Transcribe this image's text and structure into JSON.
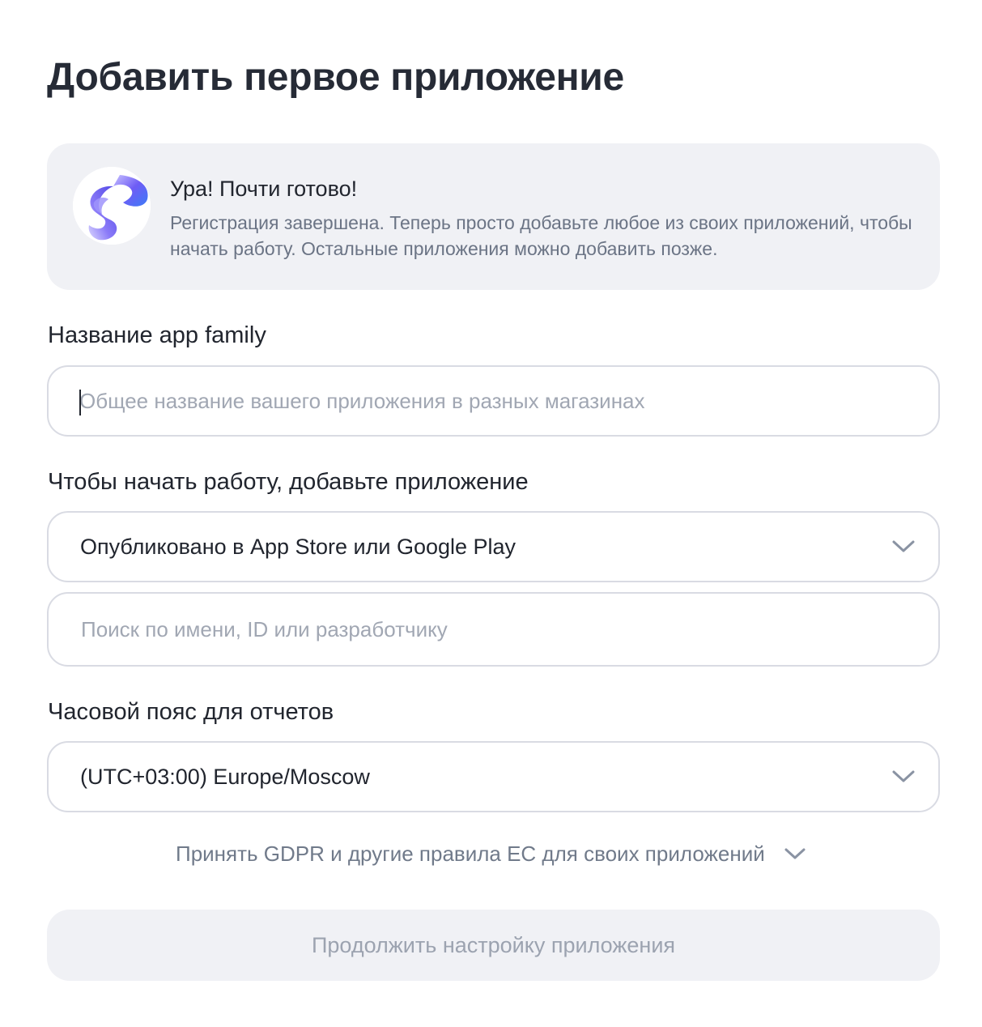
{
  "page": {
    "title": "Добавить первое приложение"
  },
  "banner": {
    "title": "Ура! Почти готово!",
    "text": "Регистрация завершена. Теперь просто добавьте любое из своих приложений, чтобы начать работу. Остальные приложения можно добавить позже."
  },
  "app_family": {
    "label": "Название app family",
    "value": "",
    "placeholder": "Общее название вашего приложения в разных магазинах"
  },
  "add_app": {
    "label": "Чтобы начать работу, добавьте приложение",
    "source_select_value": "Опубликовано в App Store или Google Play",
    "search_placeholder": "Поиск по имени, ID или разработчику"
  },
  "timezone": {
    "label": "Часовой пояс для отчетов",
    "value": "(UTC+03:00) Europe/Moscow"
  },
  "gdpr": {
    "label": "Принять GDPR и другие правила ЕС для своих приложений"
  },
  "submit": {
    "label": "Продолжить настройку приложения",
    "disabled": true
  },
  "colors": {
    "banner_bg": "#f0f1f5",
    "border": "#d9dbe3",
    "muted_text": "#6b7485",
    "placeholder": "#a1a7b3",
    "logo_gradient": [
      "#3b6cf6",
      "#8b5cf6",
      "#c4b5fd"
    ]
  },
  "icons": {
    "banner_logo": "metrica-logo-icon",
    "select_chevron": "chevron-down-icon"
  }
}
